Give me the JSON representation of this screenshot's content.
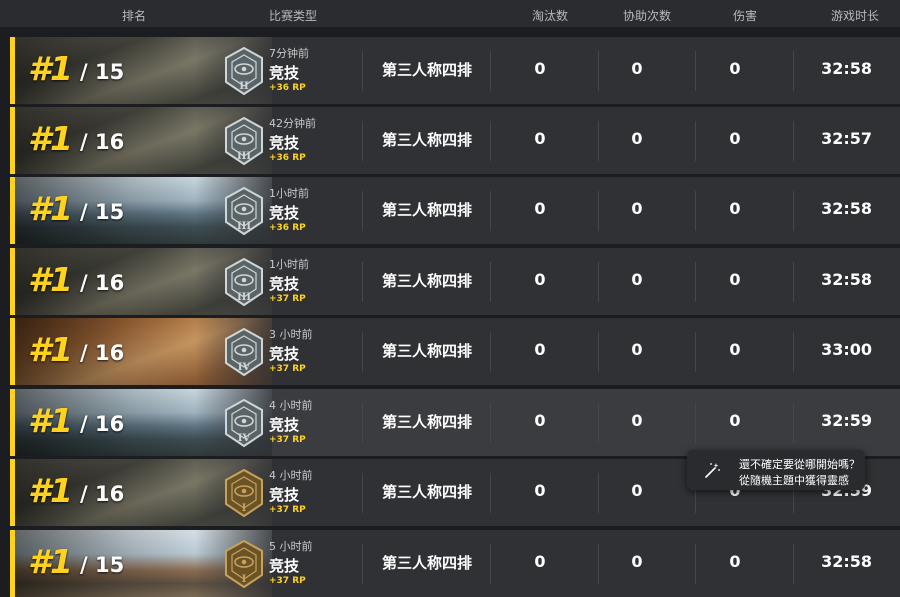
{
  "header": {
    "rank": "排名",
    "match_type": "比赛类型",
    "kills": "淘汰数",
    "assists": "协助次数",
    "damage": "伤害",
    "duration": "游戏时长"
  },
  "rows": [
    {
      "rank": "#1",
      "total": "/ 15",
      "time": "7分钟前",
      "mode": "竞技",
      "rp": "+36 RP",
      "type": "第三人称四排",
      "kills": "0",
      "assists": "0",
      "damage": "0",
      "duration": "32:58",
      "tier": "II",
      "map": "city"
    },
    {
      "rank": "#1",
      "total": "/ 16",
      "time": "42分钟前",
      "mode": "竞技",
      "rp": "+36 RP",
      "type": "第三人称四排",
      "kills": "0",
      "assists": "0",
      "damage": "0",
      "duration": "32:57",
      "tier": "III",
      "map": "city"
    },
    {
      "rank": "#1",
      "total": "/ 15",
      "time": "1小时前",
      "mode": "竞技",
      "rp": "+36 RP",
      "type": "第三人称四排",
      "kills": "0",
      "assists": "0",
      "damage": "0",
      "duration": "32:58",
      "tier": "III",
      "map": "mountain"
    },
    {
      "rank": "#1",
      "total": "/ 16",
      "time": "1小时前",
      "mode": "竞技",
      "rp": "+37 RP",
      "type": "第三人称四排",
      "kills": "0",
      "assists": "0",
      "damage": "0",
      "duration": "32:58",
      "tier": "III",
      "map": "city"
    },
    {
      "rank": "#1",
      "total": "/ 16",
      "time": "3 小时前",
      "mode": "竞技",
      "rp": "+37 RP",
      "type": "第三人称四排",
      "kills": "0",
      "assists": "0",
      "damage": "0",
      "duration": "33:00",
      "tier": "IV",
      "map": "desert"
    },
    {
      "rank": "#1",
      "total": "/ 16",
      "time": "4 小时前",
      "mode": "竞技",
      "rp": "+37 RP",
      "type": "第三人称四排",
      "kills": "0",
      "assists": "0",
      "damage": "0",
      "duration": "32:59",
      "tier": "IV",
      "map": "mountain"
    },
    {
      "rank": "#1",
      "total": "/ 16",
      "time": "4 小时前",
      "mode": "竞技",
      "rp": "+37 RP",
      "type": "第三人称四排",
      "kills": "0",
      "assists": "0",
      "damage": "0",
      "duration": "32:59",
      "tier": "I",
      "map": "city"
    },
    {
      "rank": "#1",
      "total": "/ 15",
      "time": "5 小时前",
      "mode": "竞技",
      "rp": "+37 RP",
      "type": "第三人称四排",
      "kills": "0",
      "assists": "0",
      "damage": "0",
      "duration": "32:58",
      "tier": "I",
      "map": "village"
    }
  ],
  "tooltip": {
    "line1": "還不確定要從哪開始嗎？",
    "line2": "從隨機主題中獲得靈感"
  },
  "colors": {
    "accent": "#ffd21e",
    "row_bg": "#303134",
    "row_highlight": "#3b3c40",
    "header_bg": "#2b2c30"
  },
  "icons": {
    "badge": "rank-badge-icon",
    "tooltip": "magic-wand-icon"
  }
}
